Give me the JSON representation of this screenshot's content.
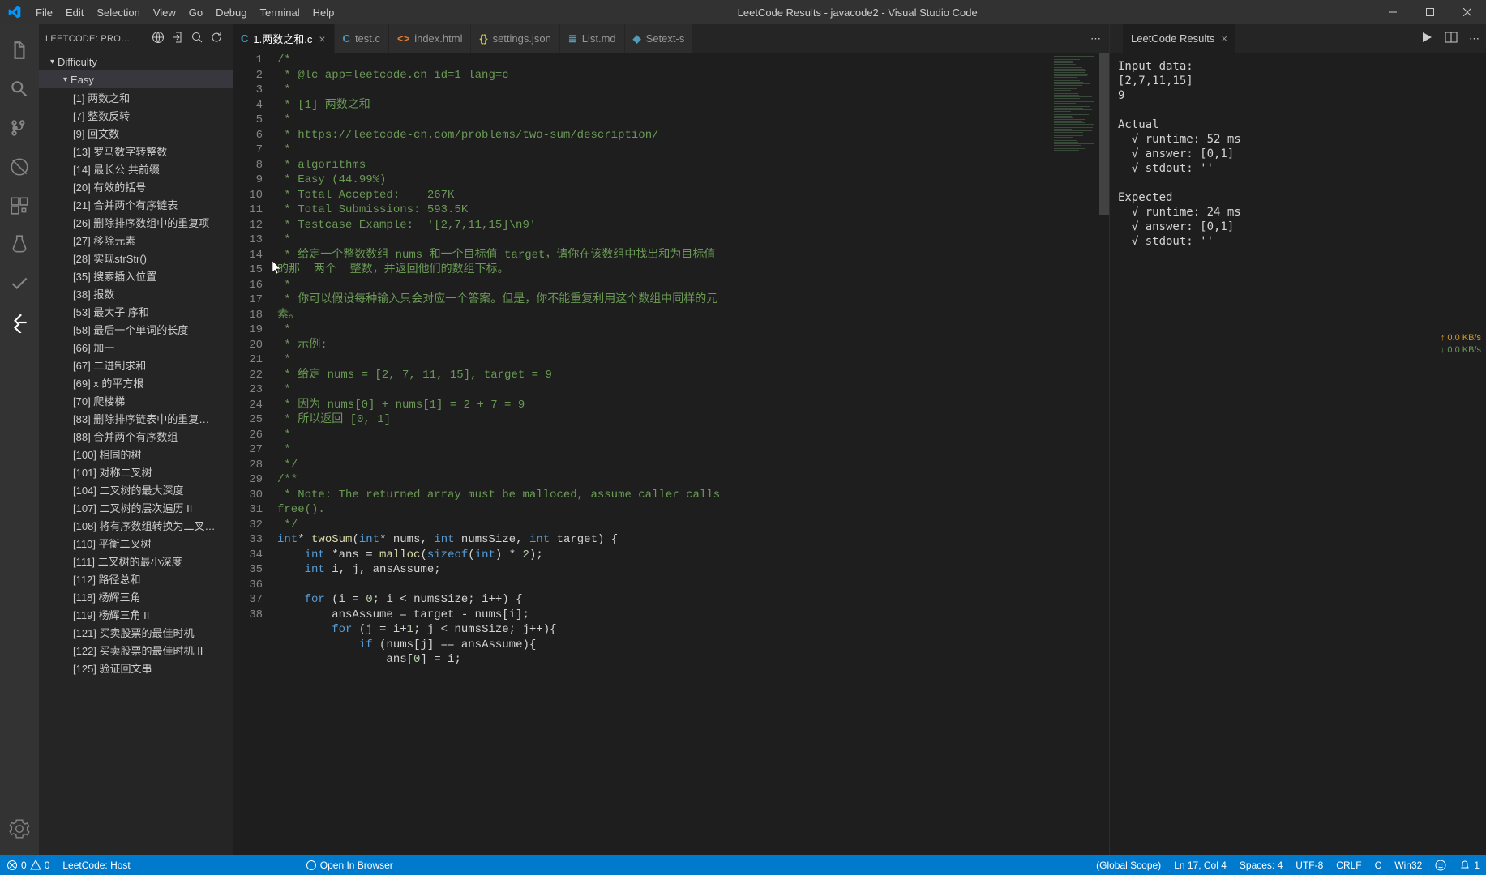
{
  "titlebar": {
    "menus": [
      "File",
      "Edit",
      "Selection",
      "View",
      "Go",
      "Debug",
      "Terminal",
      "Help"
    ],
    "title": "LeetCode Results - javacode2 - Visual Studio Code"
  },
  "sidebar": {
    "title": "LEETCODE: PRO…",
    "tree": {
      "root": "Difficulty",
      "group": "Easy",
      "items": [
        "[1] 两数之和",
        "[7] 整数反转",
        "[9] 回文数",
        "[13] 罗马数字转整数",
        "[14] 最长公 共前缀",
        "[20] 有效的括号",
        "[21] 合并两个有序链表",
        "[26] 删除排序数组中的重复项",
        "[27] 移除元素",
        "[28] 实现strStr()",
        "[35] 搜索插入位置",
        "[38] 报数",
        "[53] 最大子 序和",
        "[58] 最后一个单词的长度",
        "[66] 加一",
        "[67] 二进制求和",
        "[69] x 的平方根",
        "[70] 爬楼梯",
        "[83] 删除排序链表中的重复…",
        "[88] 合并两个有序数组",
        "[100] 相同的树",
        "[101] 对称二叉树",
        "[104] 二叉树的最大深度",
        "[107] 二叉树的层次遍历 II",
        "[108] 将有序数组转换为二叉…",
        "[110] 平衡二叉树",
        "[111] 二叉树的最小深度",
        "[112] 路径总和",
        "[118] 杨辉三角",
        "[119] 杨辉三角 II",
        "[121] 买卖股票的最佳时机",
        "[122] 买卖股票的最佳时机 II",
        "[125] 验证回文串"
      ]
    }
  },
  "tabs": {
    "items": [
      {
        "icon": "C",
        "cls": "c",
        "label": "1.两数之和.c",
        "active": true,
        "close": true
      },
      {
        "icon": "C",
        "cls": "c",
        "label": "test.c"
      },
      {
        "icon": "<>",
        "cls": "html",
        "label": "index.html"
      },
      {
        "icon": "{}",
        "cls": "json",
        "label": "settings.json"
      },
      {
        "icon": "≣",
        "cls": "md",
        "label": "List.md"
      },
      {
        "icon": "◆",
        "cls": "md",
        "label": "Setext-s"
      }
    ]
  },
  "editor": {
    "lines": [
      {
        "n": 1,
        "html": "<span class='c-comment'>/*</span>"
      },
      {
        "n": 2,
        "html": "<span class='c-comment'> * @lc app=leetcode.cn id=1 lang=c</span>"
      },
      {
        "n": 3,
        "html": "<span class='c-comment'> *</span>"
      },
      {
        "n": 4,
        "html": "<span class='c-comment'> * [1] 两数之和</span>"
      },
      {
        "n": 5,
        "html": "<span class='c-comment'> *</span>"
      },
      {
        "n": 6,
        "html": "<span class='c-comment'> * </span><span class='c-link'>https://leetcode-cn.com/problems/two-sum/description/</span>"
      },
      {
        "n": 7,
        "html": "<span class='c-comment'> *</span>"
      },
      {
        "n": 8,
        "html": "<span class='c-comment'> * algorithms</span>"
      },
      {
        "n": 9,
        "html": "<span class='c-comment'> * Easy (44.99%)</span>"
      },
      {
        "n": 10,
        "html": "<span class='c-comment'> * Total Accepted:    267K</span>"
      },
      {
        "n": 11,
        "html": "<span class='c-comment'> * Total Submissions: 593.5K</span>"
      },
      {
        "n": 12,
        "html": "<span class='c-comment'> * Testcase Example:  '[2,7,11,15]\\n9'</span>"
      },
      {
        "n": 13,
        "html": "<span class='c-comment'> *</span>"
      },
      {
        "n": 14,
        "html": "<span class='c-comment'> * 给定一个整数数组 nums 和一个目标值 target，请你在该数组中找出和为目标值</span>"
      },
      {
        "n": "",
        "html": "<span class='c-comment'>的那  两个  整数，并返回他们的数组下标。</span>"
      },
      {
        "n": 15,
        "html": "<span class='c-comment'> *</span>"
      },
      {
        "n": 16,
        "html": "<span class='c-comment'> * 你可以假设每种输入只会对应一个答案。但是，你不能重复利用这个数组中同样的元</span>"
      },
      {
        "n": "",
        "html": "<span class='c-comment'>素。</span>"
      },
      {
        "n": 17,
        "html": "<span class='c-comment'> *</span>"
      },
      {
        "n": 18,
        "html": "<span class='c-comment'> * 示例:</span>"
      },
      {
        "n": 19,
        "html": "<span class='c-comment'> *</span>"
      },
      {
        "n": 20,
        "html": "<span class='c-comment'> * 给定 nums = [2, 7, 11, 15], target = 9</span>"
      },
      {
        "n": 21,
        "html": "<span class='c-comment'> *</span>"
      },
      {
        "n": 22,
        "html": "<span class='c-comment'> * 因为 nums[0] + nums[1] = 2 + 7 = 9</span>"
      },
      {
        "n": 23,
        "html": "<span class='c-comment'> * 所以返回 [0, 1]</span>"
      },
      {
        "n": 24,
        "html": "<span class='c-comment'> *</span>"
      },
      {
        "n": 25,
        "html": "<span class='c-comment'> *</span>"
      },
      {
        "n": 26,
        "html": "<span class='c-comment'> */</span>"
      },
      {
        "n": 27,
        "html": "<span class='c-comment'>/**</span>"
      },
      {
        "n": 28,
        "html": "<span class='c-comment'> * Note: The returned array must be malloced, assume caller calls</span>"
      },
      {
        "n": "",
        "html": "<span class='c-comment'>free().</span>"
      },
      {
        "n": 29,
        "html": "<span class='c-comment'> */</span>"
      },
      {
        "n": 30,
        "html": "<span class='c-type'>int</span><span class='c-plain'>* </span><span class='c-fn'>twoSum</span><span class='c-plain'>(</span><span class='c-type'>int</span><span class='c-plain'>* nums, </span><span class='c-type'>int</span><span class='c-plain'> numsSize, </span><span class='c-type'>int</span><span class='c-plain'> target) {</span>"
      },
      {
        "n": 31,
        "html": "    <span class='c-type'>int</span><span class='c-plain'> *ans = </span><span class='c-fn'>malloc</span><span class='c-plain'>(</span><span class='c-kw'>sizeof</span><span class='c-plain'>(</span><span class='c-type'>int</span><span class='c-plain'>) * </span><span class='c-num'>2</span><span class='c-plain'>);</span>"
      },
      {
        "n": 32,
        "html": "    <span class='c-type'>int</span><span class='c-plain'> i, j, ansAssume;</span>"
      },
      {
        "n": 33,
        "html": ""
      },
      {
        "n": 34,
        "html": "    <span class='c-kw'>for</span><span class='c-plain'> (i = </span><span class='c-num'>0</span><span class='c-plain'>; i &lt; numsSize; i++) {</span>"
      },
      {
        "n": 35,
        "html": "        <span class='c-plain'>ansAssume = target - nums[i];</span>"
      },
      {
        "n": 36,
        "html": "        <span class='c-kw'>for</span><span class='c-plain'> (j = i+</span><span class='c-num'>1</span><span class='c-plain'>; j &lt; numsSize; j++){</span>"
      },
      {
        "n": 37,
        "html": "            <span class='c-kw'>if</span><span class='c-plain'> (nums[j] == ansAssume){</span>"
      },
      {
        "n": 38,
        "html": "                <span class='c-plain'>ans[</span><span class='c-num'>0</span><span class='c-plain'>] = i;</span>"
      }
    ]
  },
  "results": {
    "tab": "LeetCode Results",
    "text": "Input data:\n[2,7,11,15]\n9\n\nActual\n  √ runtime: 52 ms\n  √ answer: [0,1]\n  √ stdout: ''\n\nExpected\n  √ runtime: 24 ms\n  √ answer: [0,1]\n  √ stdout: ''"
  },
  "netspeed": {
    "up": "↑ 0.0 KB/s",
    "dn": "↓ 0.0 KB/s"
  },
  "statusbar": {
    "errors": "0",
    "warnings": "0",
    "leetcode": "LeetCode: Host",
    "openbrowser": "Open In Browser",
    "scope": "(Global Scope)",
    "lncol": "Ln 17, Col 4",
    "spaces": "Spaces: 4",
    "enc": "UTF-8",
    "eol": "CRLF",
    "lang": "C",
    "os": "Win32",
    "bell": "1"
  }
}
